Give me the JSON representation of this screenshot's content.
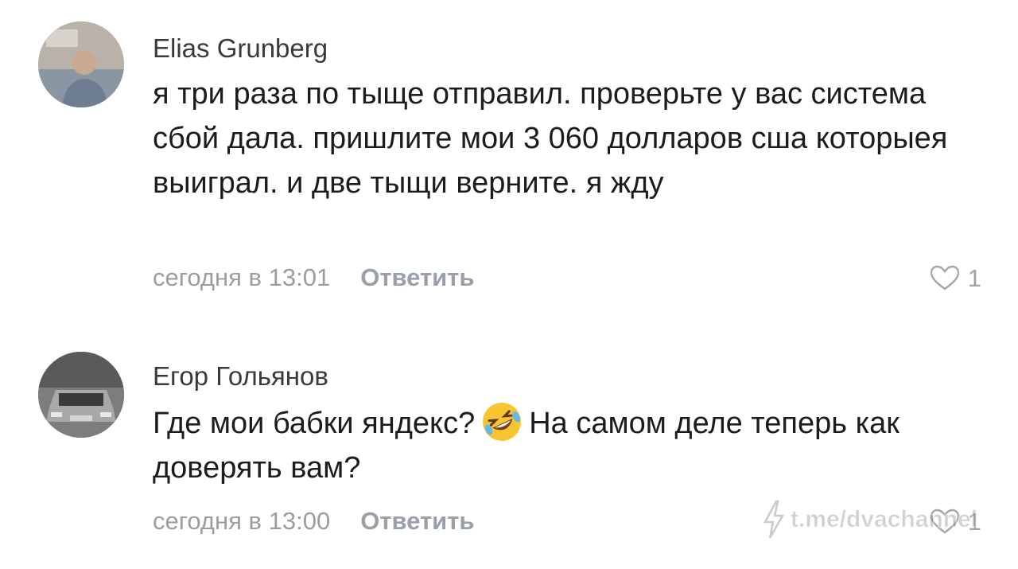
{
  "comments": [
    {
      "author": "Elias Grunberg",
      "text": "я три раза по тыще отправил. проверьте у вас система сбой дала. пришлите мои 3 060 долларов сша которыея выиграл. и две тыщи верните. я жду",
      "time": "сегодня в 13:01",
      "reply_label": "Ответить",
      "likes": "1",
      "avatar_icon": "user-photo-icon"
    },
    {
      "author": "Егор Гольянов",
      "text_before_emoji": "Где мои бабки яндекс?",
      "emoji_icon": "rolling-on-floor-laughing-emoji",
      "text_after_emoji": "На самом деле теперь как доверять вам?",
      "time": "сегодня в 13:00",
      "reply_label": "Ответить",
      "likes": "1",
      "avatar_icon": "car-photo-icon"
    }
  ],
  "watermark": {
    "text": "t.me/dvachannel",
    "icon": "lightning-bolt-icon"
  }
}
